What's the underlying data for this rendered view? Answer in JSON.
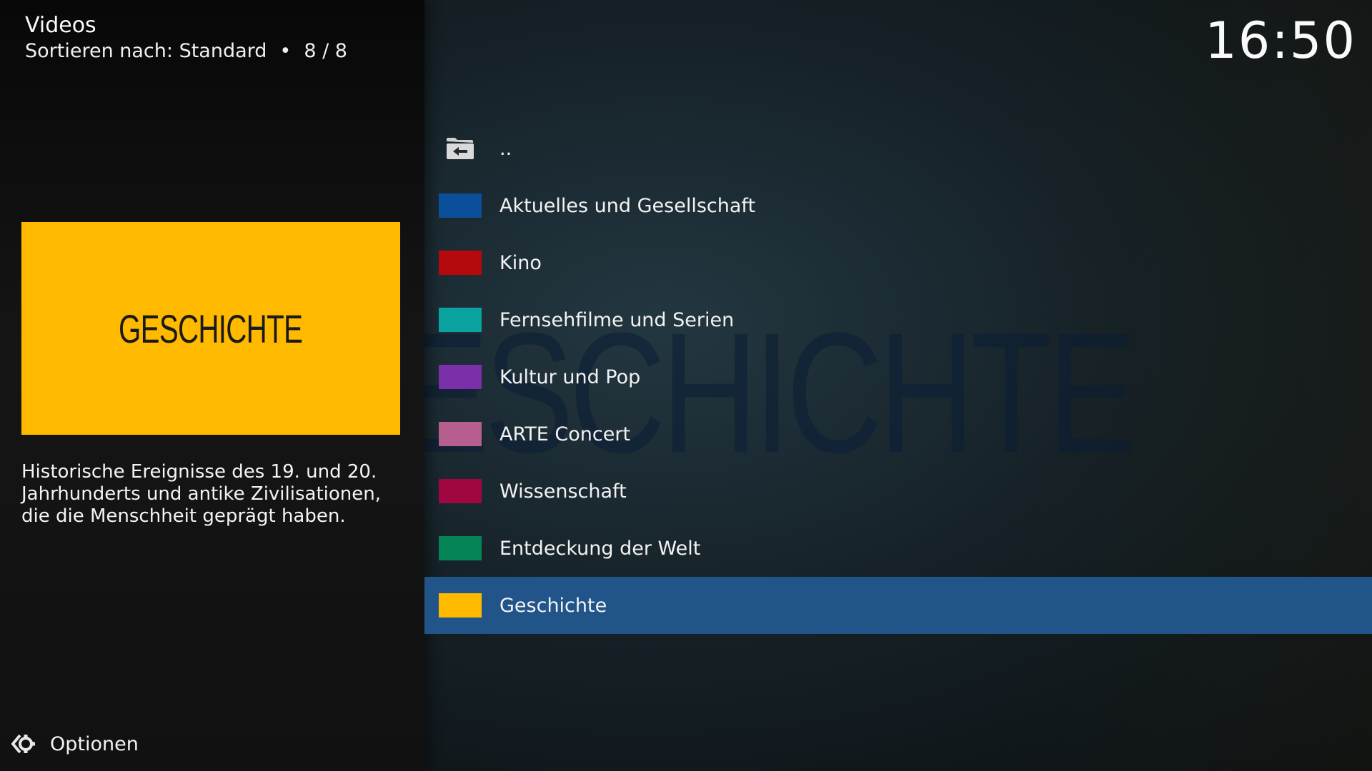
{
  "header": {
    "title": "Videos",
    "sort_label": "Sortieren nach: Standard",
    "separator": "•",
    "count": "8 / 8"
  },
  "clock": "16:50",
  "background": {
    "fanart_text": "GESCHICHTE"
  },
  "poster": {
    "text": "GESCHICHTE",
    "color": "#ffba00"
  },
  "plot": "Historische Ereignisse des 19. und 20. Jahrhunderts und antike Zivilisationen, die die Menschheit geprägt haben.",
  "options": {
    "label": "Optionen",
    "icon": "options-gear-icon"
  },
  "list": {
    "selected_index": 8,
    "items": [
      {
        "label": "..",
        "icon": "folder-back-icon",
        "color": ""
      },
      {
        "label": "Aktuelles und Gesellschaft",
        "color": "#0b4f9a"
      },
      {
        "label": "Kino",
        "color": "#b5090d"
      },
      {
        "label": "Fernsehfilme und Serien",
        "color": "#0aa3a0"
      },
      {
        "label": "Kultur und Pop",
        "color": "#7b2fa8"
      },
      {
        "label": "ARTE Concert",
        "color": "#b65f8f"
      },
      {
        "label": "Wissenschaft",
        "color": "#a0063f"
      },
      {
        "label": "Entdeckung der Welt",
        "color": "#058555"
      },
      {
        "label": "Geschichte",
        "color": "#ffba00"
      }
    ]
  }
}
